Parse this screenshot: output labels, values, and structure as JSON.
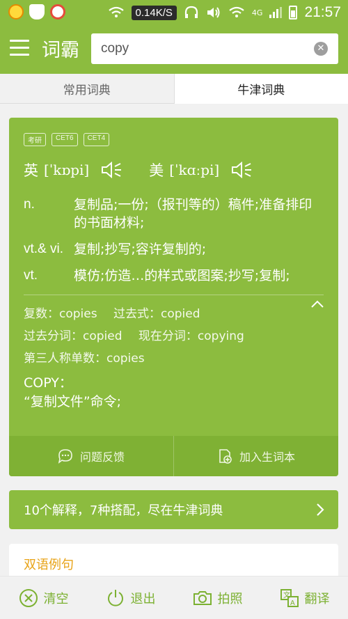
{
  "status_bar": {
    "net_speed": "0.14K/S",
    "network": "4G",
    "time": "21:57"
  },
  "app_bar": {
    "title": "词霸",
    "search": {
      "value": "copy",
      "placeholder": ""
    }
  },
  "tabs": [
    {
      "label": "常用词典",
      "active": false
    },
    {
      "label": "牛津词典",
      "active": true
    }
  ],
  "entry": {
    "tags": [
      "考研",
      "CET6",
      "CET4"
    ],
    "pron_uk": {
      "label": "英",
      "ipa": "[ˈkɒpi]"
    },
    "pron_us": {
      "label": "美",
      "ipa": "[ˈkɑːpi]"
    },
    "definitions": [
      {
        "pos": "n.",
        "meaning": "复制品;一份;（报刊等的）稿件;准备排印的书面材料;"
      },
      {
        "pos": "vt.& vi.",
        "meaning": "复制;抄写;容许复制的;"
      },
      {
        "pos": "vt.",
        "meaning": "模仿;仿造…的样式或图案;抄写;复制;"
      }
    ],
    "forms": {
      "plural": "复数：copies",
      "past": "过去式：copied",
      "past_participle": "过去分词：copied",
      "present_participle": "现在分词：copying",
      "third_person": "第三人称单数：copies"
    },
    "extra_title": "COPY：",
    "extra_text": "“复制文件”命令;",
    "actions": {
      "feedback": "问题反馈",
      "add_word": "加入生词本"
    }
  },
  "oxford_banner": "10个解释，7种搭配，尽在牛津词典",
  "examples_header": "双语例句",
  "bottom_bar": {
    "clear": "清空",
    "exit": "退出",
    "photo": "拍照",
    "translate": "翻译"
  },
  "colors": {
    "brand": "#8cbc3f",
    "accent": "#e8a317"
  }
}
